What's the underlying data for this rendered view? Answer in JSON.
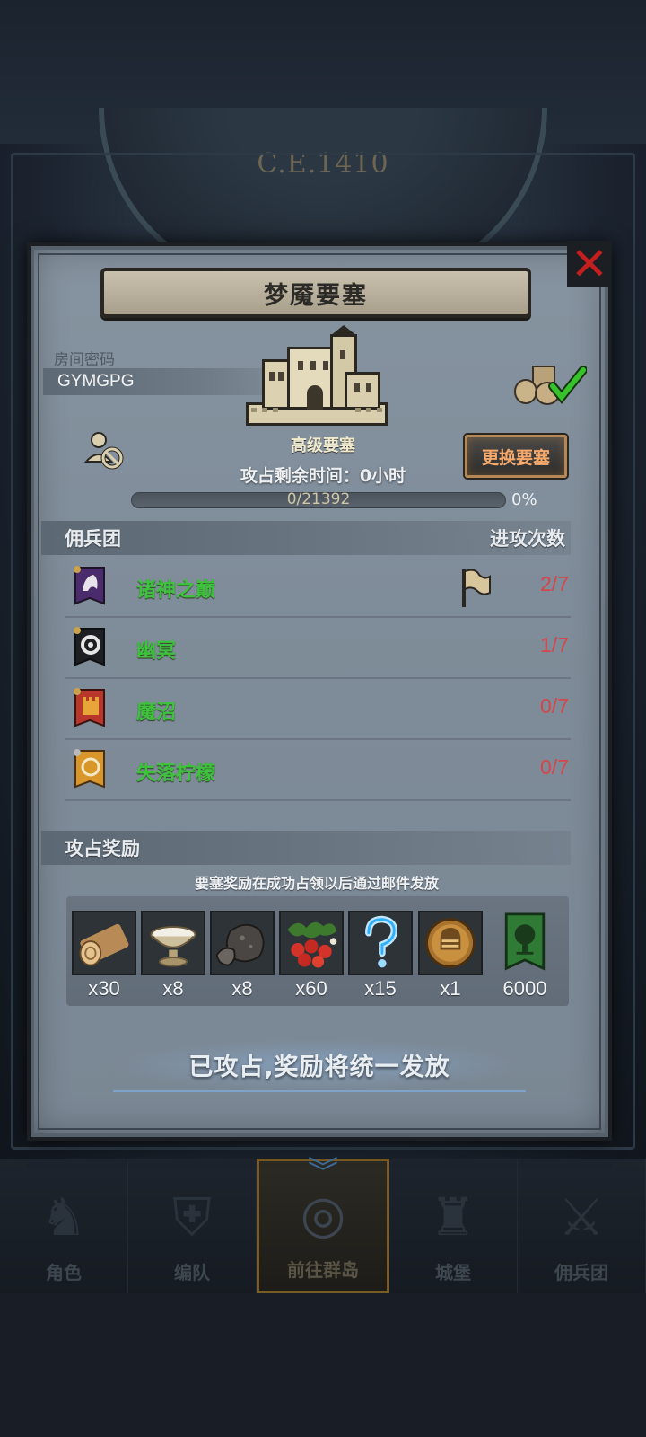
{
  "background": {
    "era_label": "C.E.1410"
  },
  "modal": {
    "title": "梦魇要塞",
    "close_icon": "close-x-icon",
    "room_code_label": "房间密码",
    "room_code": "GYMGPG",
    "fortress_level": "高级要塞",
    "change_button": "更换要塞",
    "time_remaining": "攻占剩余时间：0小时",
    "progress": {
      "text": "0/21392",
      "current": 0,
      "total": 21392,
      "percent_label": "0%"
    },
    "mercenary_header": "佣兵团",
    "attack_count_header": "进攻次数",
    "guilds": [
      {
        "name": "诸神之巅",
        "count": "2/7",
        "emblem": "purple-wolf-banner-icon",
        "has_flag": true
      },
      {
        "name": "幽冥",
        "count": "1/7",
        "emblem": "black-spiral-banner-icon",
        "has_flag": false
      },
      {
        "name": "魔沼",
        "count": "0/7",
        "emblem": "red-castle-banner-icon",
        "has_flag": false
      },
      {
        "name": "失落柠檬",
        "count": "0/7",
        "emblem": "gold-circle-banner-icon",
        "has_flag": false
      }
    ],
    "rewards_header": "攻占奖励",
    "reward_note": "要塞奖励在成功占领以后通过邮件发放",
    "rewards": [
      {
        "name": "wood-log-icon",
        "qty": "x30"
      },
      {
        "name": "milk-bowl-icon",
        "qty": "x8"
      },
      {
        "name": "stone-ore-icon",
        "qty": "x8"
      },
      {
        "name": "berries-icon",
        "qty": "x60"
      },
      {
        "name": "mystery-question-icon",
        "qty": "x15"
      },
      {
        "name": "helmet-medal-icon",
        "qty": "x1"
      },
      {
        "name": "guild-tree-banner-icon",
        "qty": "6000"
      }
    ],
    "claimed_text": "已攻占,奖励将统一发放"
  },
  "nav": [
    {
      "label": "角色",
      "icon": "character-icon"
    },
    {
      "label": "编队",
      "icon": "formation-icon"
    },
    {
      "label": "前往群岛",
      "icon": "islands-icon",
      "active": true
    },
    {
      "label": "城堡",
      "icon": "castle-icon"
    },
    {
      "label": "佣兵团",
      "icon": "mercenary-icon"
    }
  ],
  "colors": {
    "guild_name": "#3ec23e",
    "attack_count": "#d64548",
    "change_button_text": "#f6a96b",
    "close_x": "#c41e1e"
  }
}
